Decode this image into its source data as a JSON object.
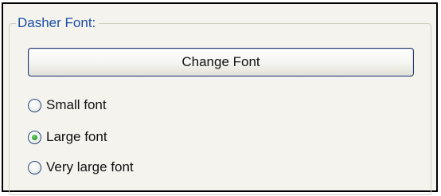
{
  "group": {
    "legend": "Dasher Font:"
  },
  "change_font_button": {
    "label": "Change Font"
  },
  "font_size_options": [
    {
      "label": "Small font",
      "checked": false
    },
    {
      "label": "Large font",
      "checked": true
    },
    {
      "label": "Very large font",
      "checked": false
    }
  ],
  "colors": {
    "legend_text": "#1f4fa3",
    "panel_background": "#f4f3ee",
    "button_border": "#1f3468",
    "radio_dot": "#2f9e2f"
  }
}
